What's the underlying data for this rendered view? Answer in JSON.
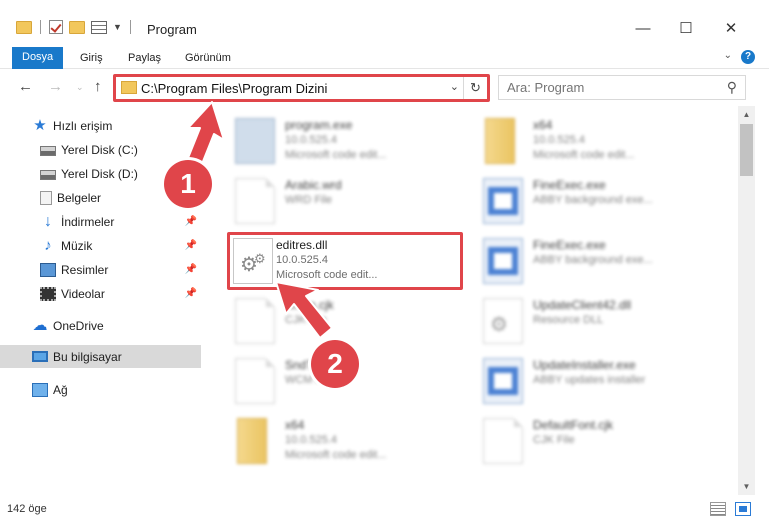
{
  "window": {
    "title": "Program",
    "controls": {
      "minimize": "—",
      "maximize": "☐",
      "close": "✕"
    }
  },
  "ribbon": {
    "tabs": [
      "Dosya",
      "Giriş",
      "Paylaş",
      "Görünüm"
    ],
    "help": "?"
  },
  "address": {
    "path": "C:\\Program Files\\Program Dizini",
    "search_placeholder": "Ara: Program"
  },
  "sidebar": {
    "items": [
      {
        "label": "Hızlı erişim",
        "icon": "quick-access-star-icon"
      },
      {
        "label": "Yerel Disk (C:)",
        "icon": "drive-icon"
      },
      {
        "label": "Yerel Disk (D:)",
        "icon": "drive-icon"
      },
      {
        "label": "Belgeler",
        "icon": "documents-icon"
      },
      {
        "label": "İndirmeler",
        "icon": "downloads-icon",
        "pinned": true
      },
      {
        "label": "Müzik",
        "icon": "music-icon",
        "pinned": true
      },
      {
        "label": "Resimler",
        "icon": "pictures-icon",
        "pinned": true
      },
      {
        "label": "Videolar",
        "icon": "videos-icon",
        "pinned": true
      },
      {
        "label": "OneDrive",
        "icon": "onedrive-icon"
      },
      {
        "label": "Bu bilgisayar",
        "icon": "this-pc-icon",
        "selected": true
      },
      {
        "label": "Ağ",
        "icon": "network-icon"
      }
    ]
  },
  "files": [
    {
      "name": "program.exe",
      "line2": "10.0.525.4",
      "line3": "Microsoft code edit..."
    },
    {
      "name": "x64",
      "line2": "10.0.525.4",
      "line3": "Microsoft code edit..."
    },
    {
      "name": "Arabic.wrd",
      "line2": "WRD File",
      "line3": ""
    },
    {
      "name": "FineExec.exe",
      "line2": "ABBY background exe...",
      "line3": ""
    },
    {
      "name": "editres.dll",
      "line2": "10.0.525.4",
      "line3": "Microsoft code edit..."
    },
    {
      "name": "FineExec.exe",
      "line2": "ABBY background exe...",
      "line3": ""
    },
    {
      "name": "Kl..an.cjk",
      "line2": "CJK File",
      "line3": ""
    },
    {
      "name": "UpdateClient42.dll",
      "line2": "Resource DLL",
      "line3": ""
    },
    {
      "name": "SndT...wcm",
      "line2": "WCM File",
      "line3": ""
    },
    {
      "name": "UpdateInstaller.exe",
      "line2": "ABBY updates installer",
      "line3": ""
    },
    {
      "name": "x64",
      "line2": "10.0.525.4",
      "line3": "Microsoft code edit..."
    },
    {
      "name": "DefaultFont.cjk",
      "line2": "CJK File",
      "line3": ""
    }
  ],
  "status": {
    "count": "142 öge"
  },
  "annotations": {
    "step1": "1",
    "step2": "2",
    "color": "#e0454a"
  }
}
